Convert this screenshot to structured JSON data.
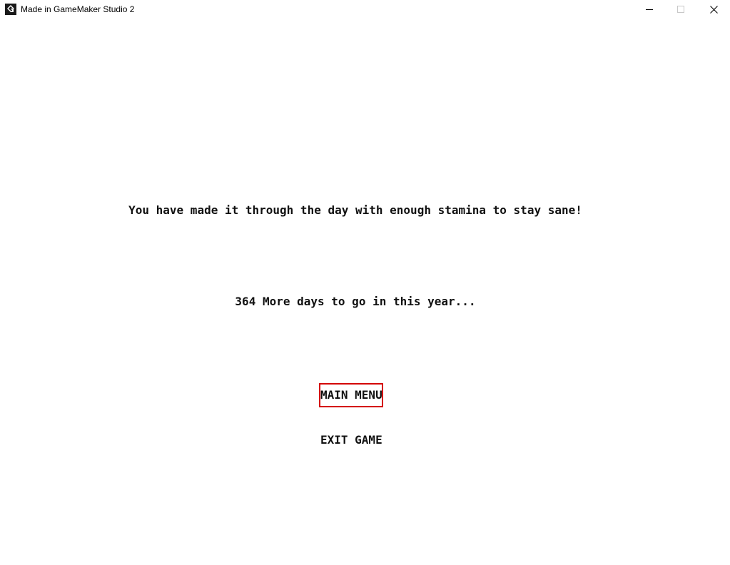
{
  "window": {
    "title": "Made in GameMaker Studio 2",
    "icon": "gamemaker-icon",
    "controls": {
      "minimize": "minimize-icon",
      "maximize": "maximize-icon",
      "close": "close-icon"
    }
  },
  "game": {
    "message": "You have made it through the day with enough stamina to stay sane!",
    "days_remaining_text": "364 More days to go in this year...",
    "menu": {
      "main_menu_label": "MAIN MENU",
      "exit_game_label": "EXIT GAME",
      "selected": "MAIN MENU",
      "selection_color": "#d40000"
    }
  }
}
